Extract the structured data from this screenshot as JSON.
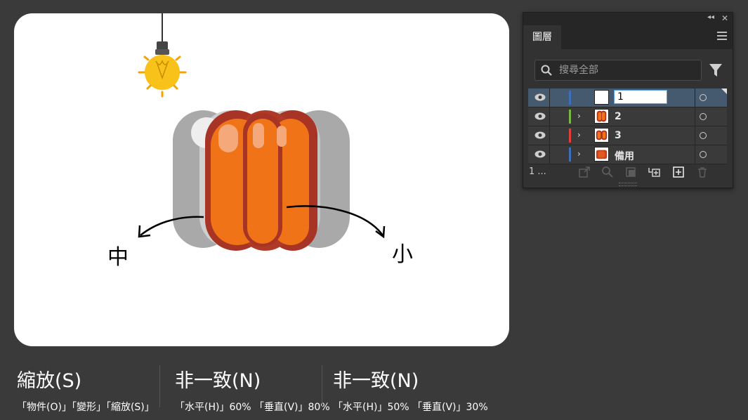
{
  "canvas": {
    "label_mid": "中",
    "label_small": "小"
  },
  "layers_panel": {
    "tab_label": "圖層",
    "search_placeholder": "搜尋全部",
    "layers": [
      {
        "name": "1",
        "color": "#3d6fbf",
        "expandable": false,
        "selected": true,
        "editing": true
      },
      {
        "name": "2",
        "color": "#7ab648",
        "expandable": true,
        "selected": false,
        "editing": false
      },
      {
        "name": "3",
        "color": "#e0403a",
        "expandable": true,
        "selected": false,
        "editing": false
      },
      {
        "name": "備用",
        "color": "#3d6fbf",
        "expandable": true,
        "selected": false,
        "editing": false
      }
    ],
    "layer_count": "1 ...",
    "icons": {
      "collapse": "double-chevron-left-icon",
      "close": "close-icon",
      "menu": "hamburger-menu-icon",
      "search": "search-icon",
      "filter": "filter-icon",
      "visibility": "eye-icon",
      "expand": "chevron-right-icon",
      "target": "target-circle-icon",
      "export": "export-icon",
      "locate": "locate-object-icon",
      "clipping": "clipping-mask-icon",
      "new_sublayer": "new-sublayer-icon",
      "new_layer": "new-layer-icon",
      "delete": "trash-icon"
    }
  },
  "captions": [
    {
      "title": "縮放(S)",
      "subtitle": "「物件(O)」「變形」「縮放(S)」"
    },
    {
      "title": "非一致(N)",
      "subtitle": "「水平(H)」60% 「垂直(V)」80%"
    },
    {
      "title": "非一致(N)",
      "subtitle": "「水平(H)」50% 「垂直(V)」30%"
    }
  ],
  "colors": {
    "background": "#3a3a3a",
    "pumpkin_orange": "#f07318",
    "pumpkin_dark": "#a83426",
    "ghost_gray": "#b9b9b9",
    "bulb_yellow": "#f5b800",
    "selected_row": "#455a6e"
  }
}
